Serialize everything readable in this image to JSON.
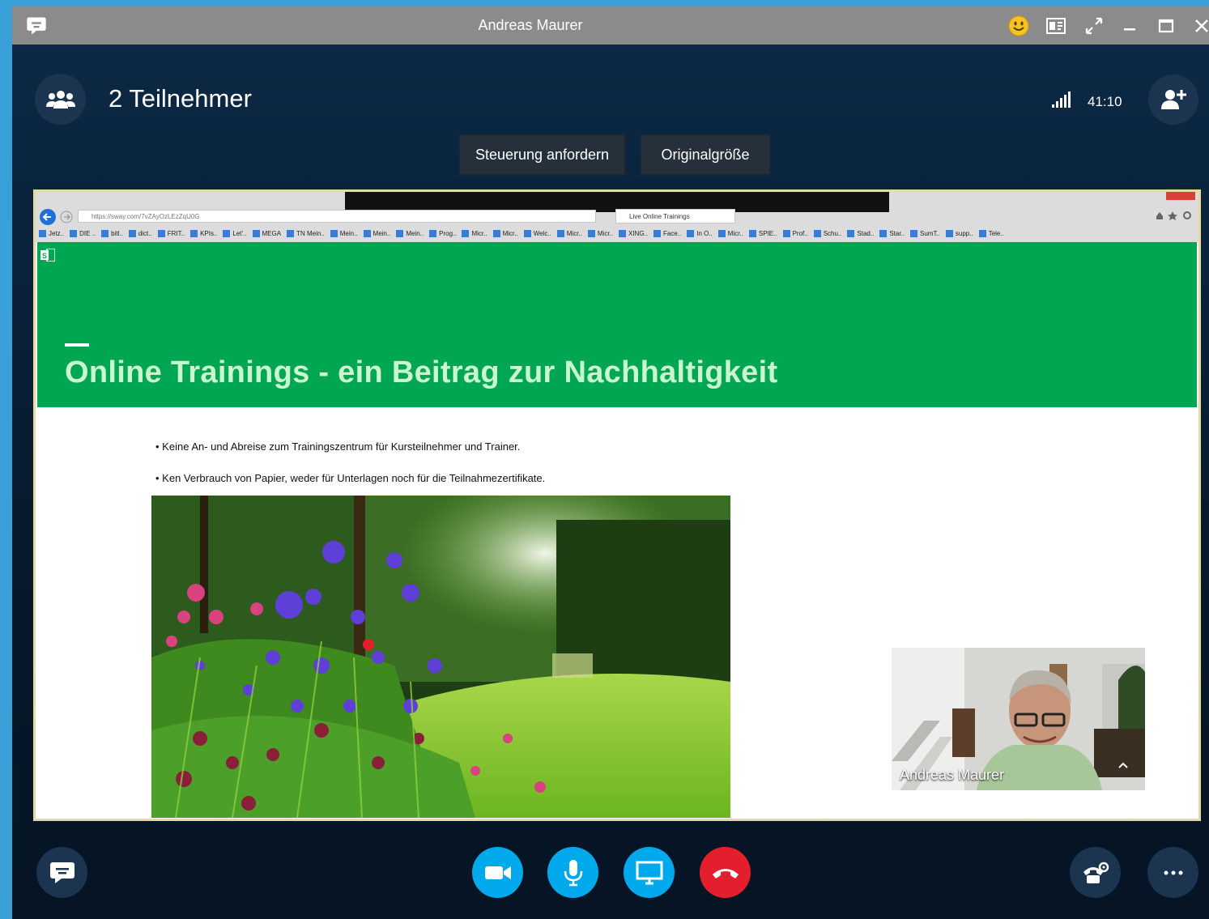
{
  "window": {
    "title": "Andreas Maurer"
  },
  "header": {
    "participants": "2 Teilnehmer",
    "timer": "41:10"
  },
  "actions": {
    "request_control": "Steuerung anfordern",
    "original_size": "Originalgröße"
  },
  "browser": {
    "url": "https://sway.com/7vZAyOzLEzZqU0G",
    "tab": "Live Online Trainings",
    "favorites": [
      "Jetz..",
      "DIE ..",
      "bitl..",
      "dict..",
      "FRIT..",
      "KPIs..",
      "Let'..",
      "MEGA",
      "TN Mein..",
      "Mein..",
      "Mein..",
      "Mein..",
      "Prog..",
      "Micr..",
      "Micr..",
      "Welc..",
      "Micr..",
      "Micr..",
      "XING..",
      "Face..",
      "In O..",
      "Micr..",
      "SPIE..",
      "Prof..",
      "Schu..",
      "Stad..",
      "Star..",
      "SumT..",
      "supp..",
      "Tele.."
    ]
  },
  "slide": {
    "title": "Online Trainings - ein Beitrag zur Nachhaltigkeit",
    "bullets": [
      "Keine An- und Abreise zum Trainingszentrum für  Kursteilnehmer und Trainer.",
      "Ken Verbrauch von Papier, weder für Unterlagen noch für die Teilnahmezertifikate."
    ]
  },
  "self_view": {
    "name": "Andreas Maurer"
  },
  "colors": {
    "accent_blue": "#00a9ec",
    "hangup_red": "#e41f2d",
    "sway_green": "#00a651"
  }
}
